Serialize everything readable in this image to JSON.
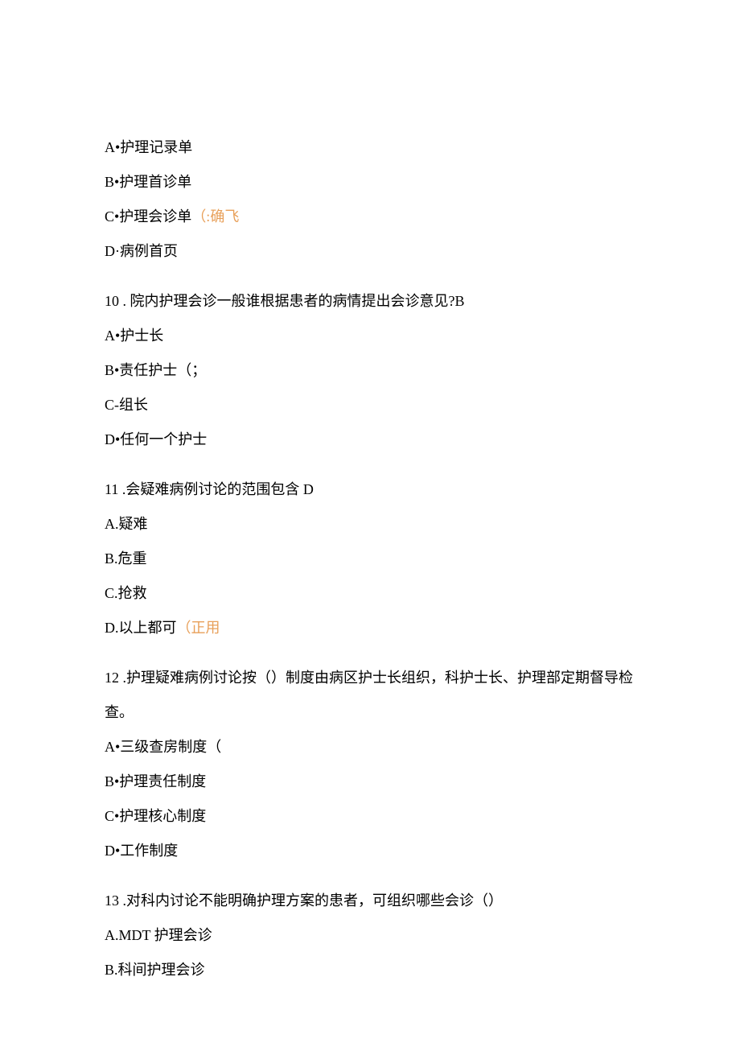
{
  "q9": {
    "optA": "A•护理记录单",
    "optB": "B•护理首诊单",
    "optC_prefix": "C•护理会诊单",
    "optC_highlight": "（:确飞",
    "optD": "D·病例首页"
  },
  "q10": {
    "num": "10",
    "stem": " . 院内护理会诊一般谁根据患者的病情提出会诊意见?B",
    "optA": "A•护士长",
    "optB": "B•责任护士（；",
    "optC": "C-组长",
    "optD": "D•任何一个护士"
  },
  "q11": {
    "num": "11",
    "stem": " .会疑难病例讨论的范围包含 D",
    "optA": "A.疑难",
    "optB": "B.危重",
    "optC": "C.抢救",
    "optD_prefix": "D.以上都可",
    "optD_highlight": "（正用"
  },
  "q12": {
    "num": "12",
    "stem1": " .护理疑难病例讨论按（）制度由病区护士长组织，科护士长、护理部定期督导检",
    "stem2": "查。",
    "optA": "A•三级查房制度（",
    "optB": "B•护理责任制度",
    "optC": "C•护理核心制度",
    "optD": "D•工作制度"
  },
  "q13": {
    "num": "13",
    "stem": " .对科内讨论不能明确护理方案的患者，可组织哪些会诊（）",
    "optA": "A.MDT 护理会诊",
    "optB": "B.科间护理会诊"
  }
}
